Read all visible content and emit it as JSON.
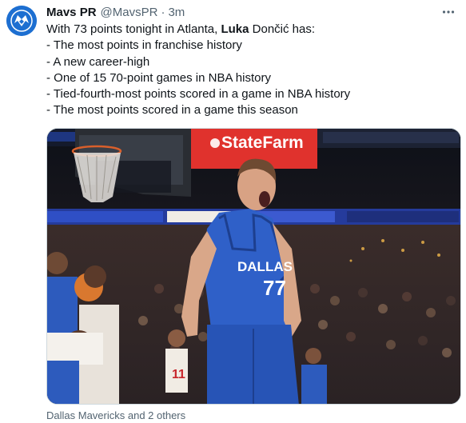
{
  "tweet": {
    "display_name": "Mavs PR",
    "handle": "@MavsPR",
    "separator": "·",
    "time": "3m",
    "intro_prefix": "With 73 points tonight in Atlanta, ",
    "intro_bold": "Luka",
    "intro_suffix": " Dončić has:",
    "bullets": [
      "- The most points in franchise history",
      "- A new career-high",
      "- One of 15 70-point games in NBA history",
      "- Tied-fourth-most points scored in a game in NBA history",
      "- The most points scored in a game this season"
    ],
    "media": {
      "sponsor_sign": "StateFarm",
      "jersey_team": "DALLAS",
      "jersey_number": "77",
      "alt_player_number": "11"
    },
    "caption": "Dallas Mavericks and 2 others"
  },
  "icons": {
    "avatar": "mavericks-logo-icon",
    "more": "more-horizontal-icon"
  },
  "colors": {
    "mavs_blue": "#1d6fd1",
    "text_primary": "#0f1419",
    "text_secondary": "#536471"
  }
}
